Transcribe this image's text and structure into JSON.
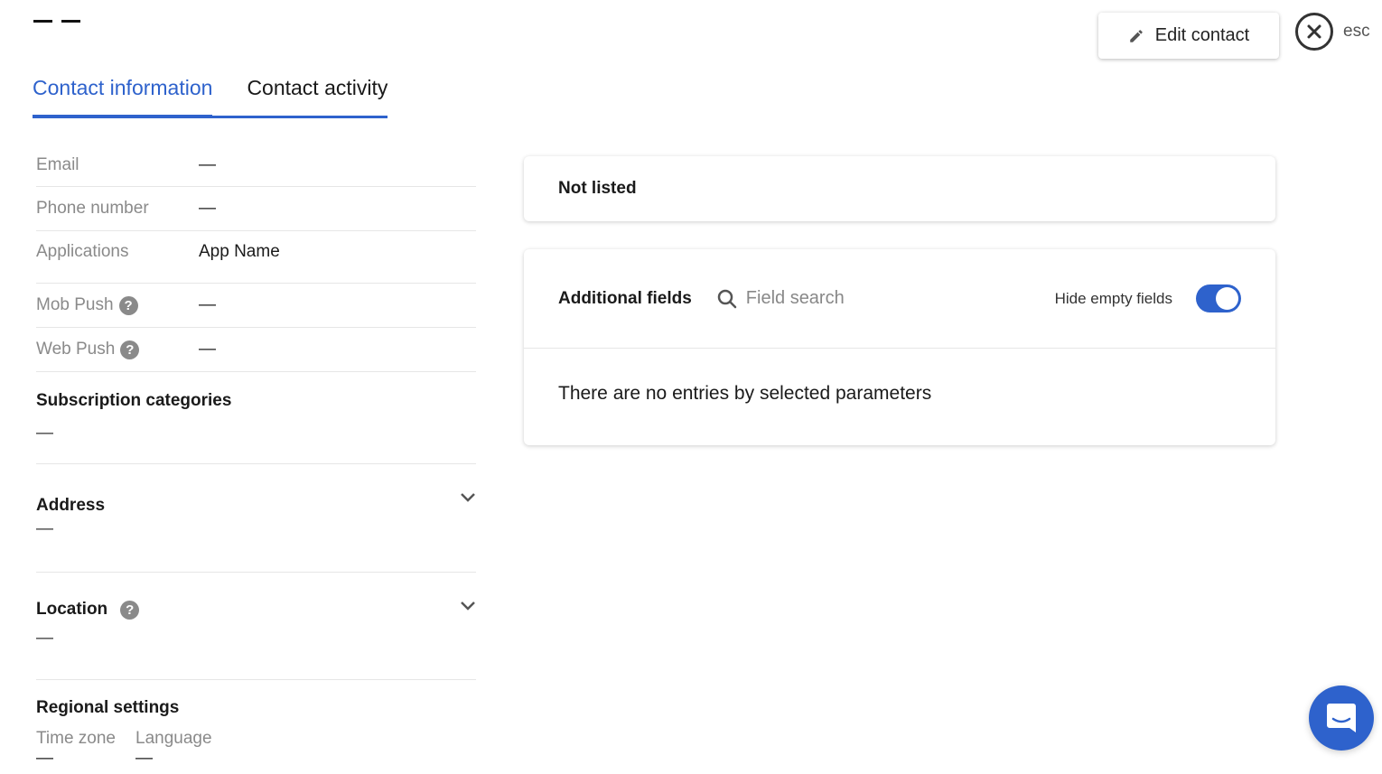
{
  "header": {
    "contact_name": "— —",
    "edit_label": "Edit contact",
    "esc_label": "esc"
  },
  "tabs": [
    {
      "label": "Contact information",
      "active": true
    },
    {
      "label": "Contact activity",
      "active": false
    }
  ],
  "contact": {
    "rows": [
      {
        "label": "Email",
        "value": "—"
      },
      {
        "label": "Phone number",
        "value": "—"
      },
      {
        "label": "Applications",
        "value": "App Name"
      },
      {
        "label": "Mob Push",
        "value": "—"
      },
      {
        "label": "Web Push",
        "value": "—"
      }
    ],
    "subscription": {
      "title": "Subscription categories",
      "value": "—"
    },
    "address": {
      "title": "Address",
      "value": "—"
    },
    "location": {
      "title": "Location",
      "value": "—"
    },
    "regional": {
      "title": "Regional settings",
      "timezone_label": "Time zone",
      "timezone_value": "—",
      "language_label": "Language",
      "language_value": "—"
    }
  },
  "right": {
    "not_listed": "Not listed",
    "additional_fields": {
      "title": "Additional fields",
      "search_placeholder": "Field search",
      "hide_empty_label": "Hide empty fields",
      "hide_empty_on": true,
      "empty_message": "There are no entries by selected parameters"
    }
  },
  "colors": {
    "accent": "#2e62cc"
  }
}
